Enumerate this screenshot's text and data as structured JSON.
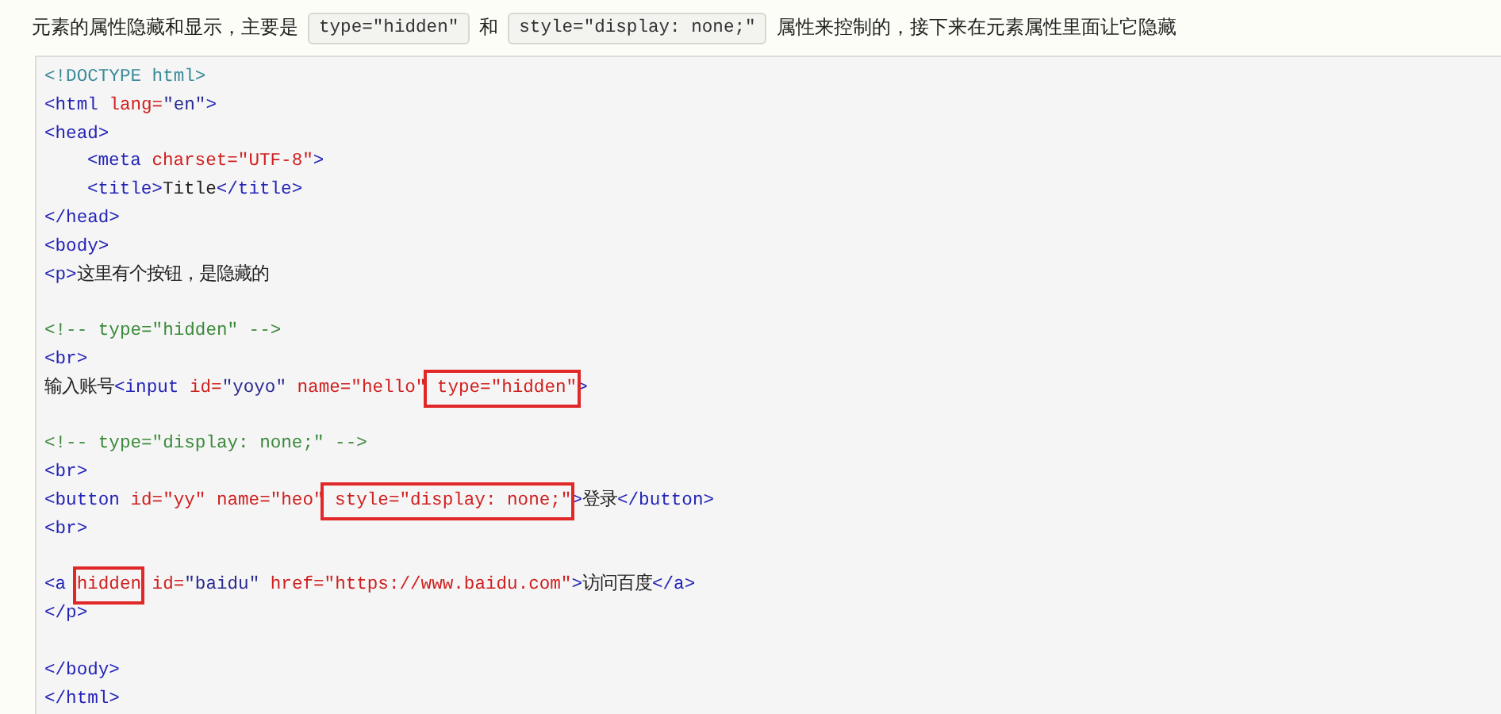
{
  "intro": [
    {
      "kind": "text",
      "text": "元素的属性隐藏和显示，主要是"
    },
    {
      "kind": "code",
      "text": "type=\"hidden\""
    },
    {
      "kind": "text",
      "text": "和"
    },
    {
      "kind": "code",
      "text": "style=\"display: none;\""
    },
    {
      "kind": "text",
      "text": "属性来控制的，接下来在元素属性里面让它隐藏"
    }
  ],
  "code_lines": [
    {
      "kind": "code",
      "tokens": [
        {
          "kind": "doctype",
          "text": "<!DOCTYPE html>"
        }
      ]
    },
    {
      "kind": "code",
      "tokens": [
        {
          "kind": "tag",
          "text": "<html "
        },
        {
          "kind": "attr",
          "text": "lang="
        },
        {
          "kind": "value",
          "text": "\"en\""
        },
        {
          "kind": "tag",
          "text": ">"
        }
      ]
    },
    {
      "kind": "code",
      "tokens": [
        {
          "kind": "tag",
          "text": "<head>"
        }
      ]
    },
    {
      "kind": "indented",
      "tokens": [
        {
          "kind": "tag",
          "text": "<meta "
        },
        {
          "kind": "attr",
          "text": "charset=\"UTF-8\""
        },
        {
          "kind": "tag",
          "text": ">"
        }
      ]
    },
    {
      "kind": "indented",
      "tokens": [
        {
          "kind": "tag",
          "text": "<title>"
        },
        {
          "kind": "text",
          "text": "Title"
        },
        {
          "kind": "tag",
          "text": "</title>"
        }
      ]
    },
    {
      "kind": "code",
      "tokens": [
        {
          "kind": "tag",
          "text": "</head>"
        }
      ]
    },
    {
      "kind": "code",
      "tokens": [
        {
          "kind": "tag",
          "text": "<body>"
        }
      ]
    },
    {
      "kind": "code",
      "tokens": [
        {
          "kind": "tag",
          "text": "<p>"
        },
        {
          "kind": "text",
          "text": "这里有个按钮，是隐藏的"
        }
      ]
    },
    {
      "kind": "blank"
    },
    {
      "kind": "code",
      "tokens": [
        {
          "kind": "comment",
          "text": "<!-- type=\"hidden\" -->"
        }
      ]
    },
    {
      "kind": "code",
      "tokens": [
        {
          "kind": "tag",
          "text": "<br>"
        }
      ]
    },
    {
      "kind": "code",
      "tokens": [
        {
          "kind": "text",
          "text": "输入账号"
        },
        {
          "kind": "tag",
          "text": "<input "
        },
        {
          "kind": "attr",
          "text": "id="
        },
        {
          "kind": "value",
          "text": "\"yoyo\" "
        },
        {
          "kind": "attr",
          "text": "name=\"hello\""
        },
        {
          "kind": "boxed",
          "text": " type=\"hidden\""
        },
        {
          "kind": "tag",
          "text": ">"
        }
      ]
    },
    {
      "kind": "blank"
    },
    {
      "kind": "code",
      "tokens": [
        {
          "kind": "comment",
          "text": "<!-- type=\"display: none;\" -->"
        }
      ]
    },
    {
      "kind": "code",
      "tokens": [
        {
          "kind": "tag",
          "text": "<br>"
        }
      ]
    },
    {
      "kind": "code",
      "tokens": [
        {
          "kind": "tag",
          "text": "<button "
        },
        {
          "kind": "attr",
          "text": "id=\"yy\" name=\"heo\""
        },
        {
          "kind": "boxed",
          "text": " style=\"display: none;\""
        },
        {
          "kind": "tag",
          "text": ">"
        },
        {
          "kind": "text",
          "text": "登录"
        },
        {
          "kind": "tag",
          "text": "</button>"
        }
      ]
    },
    {
      "kind": "code",
      "tokens": [
        {
          "kind": "tag",
          "text": "<br>"
        }
      ]
    },
    {
      "kind": "blank"
    },
    {
      "kind": "code",
      "tokens": [
        {
          "kind": "tag",
          "text": "<a "
        },
        {
          "kind": "boxed",
          "text": "hidden"
        },
        {
          "kind": "attr",
          "text": " id="
        },
        {
          "kind": "value",
          "text": "\"baidu\" "
        },
        {
          "kind": "attr",
          "text": "href=\"https://www.baidu.com\""
        },
        {
          "kind": "tag",
          "text": ">"
        },
        {
          "kind": "text",
          "text": "访问百度"
        },
        {
          "kind": "tag",
          "text": "</a>"
        }
      ]
    },
    {
      "kind": "code",
      "tokens": [
        {
          "kind": "tag",
          "text": "</p>"
        }
      ]
    },
    {
      "kind": "blank"
    },
    {
      "kind": "code",
      "tokens": [
        {
          "kind": "tag",
          "text": "</body>"
        }
      ]
    },
    {
      "kind": "code",
      "tokens": [
        {
          "kind": "tag",
          "text": "</html>"
        }
      ]
    }
  ]
}
